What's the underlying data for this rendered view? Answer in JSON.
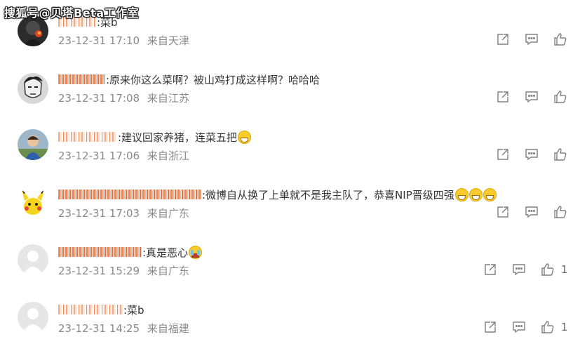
{
  "watermark": "搜狐号@贝塔Beta工作室",
  "comments": [
    {
      "name_hint": "ヤ",
      "text": ":菜b",
      "emoji": "",
      "date": "23-12-31 17:10",
      "location": "来自天津",
      "likes": ""
    },
    {
      "name_hint": "",
      "text": ":原来你这么菜啊？被山鸡打成这样啊？哈哈哈",
      "emoji": "",
      "date": "23-12-31 17:08",
      "location": "来自江苏",
      "likes": ""
    },
    {
      "name_hint": "",
      "text": ":建议回家养猪，连菜五把",
      "emoji": "laugh-cry-emoji",
      "date": "23-12-31 17:06",
      "location": "来自浙江",
      "likes": ""
    },
    {
      "name_hint": "",
      "text": ":微博自从换了上单就不是我主队了，恭喜NIP晋级四强",
      "emoji": "grin-emoji",
      "date": "23-12-31 17:03",
      "location": "来自广东",
      "likes": ""
    },
    {
      "name_hint": "",
      "text": ":真是恶心",
      "emoji": "cry-emoji",
      "date": "23-12-31 15:29",
      "location": "来自广东",
      "likes": "1"
    },
    {
      "name_hint": "",
      "text": ":菜b",
      "emoji": "",
      "date": "23-12-31 14:25",
      "location": "来自福建",
      "likes": "1"
    }
  ],
  "icons": {
    "share": "share-icon",
    "comment": "comment-icon",
    "like": "like-icon"
  },
  "colors": {
    "timestamp": "#8a8a8a",
    "text": "#333333",
    "icon": "#808080"
  }
}
